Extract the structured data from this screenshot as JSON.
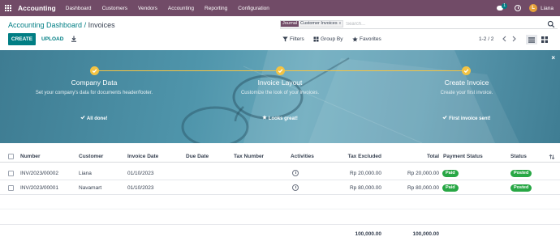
{
  "navbar": {
    "app_name": "Accounting",
    "menu": [
      "Dashboard",
      "Customers",
      "Vendors",
      "Accounting",
      "Reporting",
      "Configuration"
    ],
    "message_count": "1",
    "user_initial": "L",
    "user_name": "Liana"
  },
  "breadcrumb": {
    "parent": "Accounting Dashboard",
    "separator": "/",
    "current": "Invoices"
  },
  "search": {
    "facet_name": "Journal",
    "facet_value": "Customer Invoices",
    "facet_remove": "x",
    "placeholder": "Search..."
  },
  "actions": {
    "create": "CREATE",
    "upload": "UPLOAD"
  },
  "filters": {
    "filters_label": "Filters",
    "group_by_label": "Group By",
    "favorites_label": "Favorites"
  },
  "pager": {
    "value": "1-2 / 2"
  },
  "banner": {
    "close": "×",
    "steps": [
      {
        "title": "Company Data",
        "description": "Set your company's data for documents header/footer.",
        "status": "All done!"
      },
      {
        "title": "Invoice Layout",
        "description": "Customize the look of your invoices.",
        "status": "Looks great!"
      },
      {
        "title": "Create Invoice",
        "description": "Create your first invoice.",
        "status": "First invoice sent!"
      }
    ]
  },
  "table": {
    "columns": {
      "number": "Number",
      "customer": "Customer",
      "invoice_date": "Invoice Date",
      "due_date": "Due Date",
      "tax_number": "Tax Number",
      "activities": "Activities",
      "tax_excluded": "Tax Excluded",
      "total": "Total",
      "payment_status": "Payment Status",
      "status": "Status"
    },
    "rows": [
      {
        "number": "INV/2023/00002",
        "customer": "Liana",
        "invoice_date": "01/10/2023",
        "due_date": "",
        "tax_number": "",
        "tax_excluded": "Rp 20,000.00",
        "total": "Rp 20,000.00",
        "payment_status": "Paid",
        "status": "Posted"
      },
      {
        "number": "INV/2023/00001",
        "customer": "Navamart",
        "invoice_date": "01/10/2023",
        "due_date": "",
        "tax_number": "",
        "tax_excluded": "Rp 80,000.00",
        "total": "Rp 80,000.00",
        "payment_status": "Paid",
        "status": "Posted"
      }
    ],
    "totals": {
      "tax_excluded": "100,000.00",
      "total": "100,000.00"
    }
  },
  "colors": {
    "navbar": "#714b67",
    "primary": "#017e84",
    "step_accent": "#f3c343",
    "badge_success": "#28a745"
  }
}
